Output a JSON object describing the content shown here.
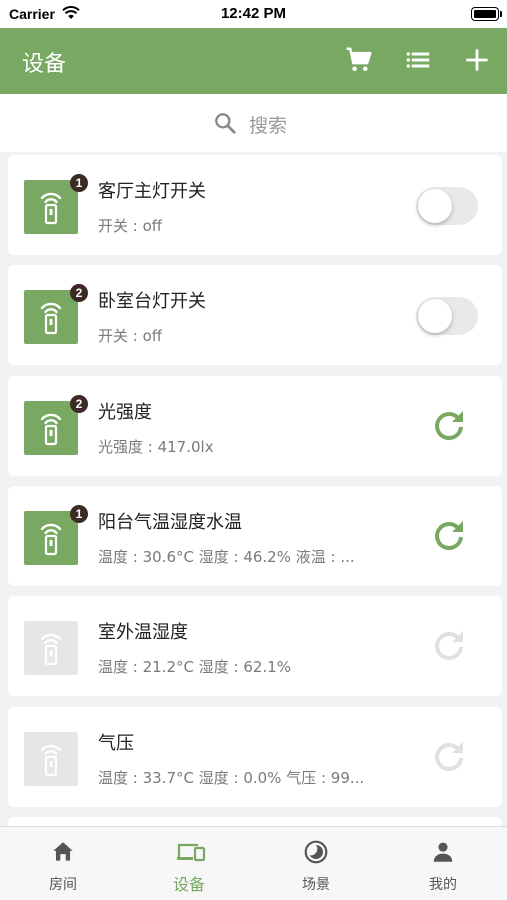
{
  "status_bar": {
    "carrier": "Carrier",
    "time": "12:42 PM"
  },
  "nav": {
    "title": "设备",
    "icons": [
      "cart-icon",
      "list-icon",
      "plus-icon"
    ]
  },
  "search": {
    "placeholder": "搜索"
  },
  "devices": [
    {
      "name": "客厅主灯开关",
      "status": "开关 : off",
      "badge": "1",
      "online": true,
      "control": "toggle",
      "toggle_on": false
    },
    {
      "name": "卧室台灯开关",
      "status": "开关 : off",
      "badge": "2",
      "online": true,
      "control": "toggle",
      "toggle_on": false
    },
    {
      "name": "光强度",
      "status": "光强度 : 417.0lx",
      "badge": "2",
      "online": true,
      "control": "refresh"
    },
    {
      "name": "阳台气温湿度水温",
      "status": "温度 : 30.6°C  湿度 : 46.2%  液温 : ...",
      "badge": "1",
      "online": true,
      "control": "refresh"
    },
    {
      "name": "室外温湿度",
      "status": "温度 : 21.2°C  湿度 : 62.1%",
      "badge": "",
      "online": false,
      "control": "refresh"
    },
    {
      "name": "气压",
      "status": "温度 : 33.7°C  湿度 : 0.0%  气压 : 99...",
      "badge": "",
      "online": false,
      "control": "refresh"
    }
  ],
  "tabs": [
    {
      "label": "房间",
      "icon": "home-icon",
      "active": false
    },
    {
      "label": "设备",
      "icon": "devices-icon",
      "active": true
    },
    {
      "label": "场景",
      "icon": "scene-icon",
      "active": false
    },
    {
      "label": "我的",
      "icon": "profile-icon",
      "active": false
    }
  ],
  "colors": {
    "brand": "#79a863",
    "offline_icon": "#e6e6e6",
    "badge": "#3c2a25",
    "refresh_active": "#79a863",
    "refresh_inactive": "#e0e0e0"
  }
}
